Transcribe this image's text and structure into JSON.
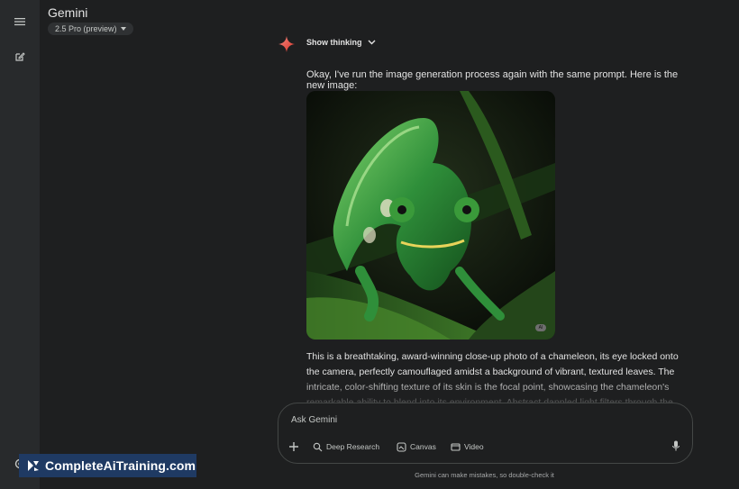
{
  "header": {
    "title": "Gemini",
    "model_label": "2.5 Pro (preview)"
  },
  "rail": {
    "menu_icon": "hamburger-menu-icon",
    "new_chat_icon": "edit-new-chat-icon",
    "settings_icon": "gear-icon"
  },
  "response": {
    "show_thinking_label": "Show thinking",
    "intro": "Okay, I've run the image generation process again with the same prompt. Here is the new image:",
    "image_badge": "AI",
    "body": "This is a breathtaking, award-winning close-up photo of a chameleon, its eye locked onto the camera, perfectly camouflaged amidst a background of vibrant, textured leaves. The intricate, color-shifting texture of its skin is the focal point, showcasing the chameleon's remarkable ability to blend into its environment. Abstract dappled light filters through the leaves, creating a"
  },
  "composer": {
    "placeholder": "Ask Gemini",
    "tools": [
      {
        "label": "Deep Research",
        "icon": "deep-research-icon"
      },
      {
        "label": "Canvas",
        "icon": "canvas-icon"
      },
      {
        "label": "Video",
        "icon": "video-icon"
      }
    ]
  },
  "disclaimer": "Gemini can make mistakes, so double-check it",
  "watermark": {
    "text": "CompleteAiTraining.com"
  },
  "colors": {
    "background": "#1e1f20",
    "rail": "#282a2c",
    "text": "#e3e3e3",
    "muted": "#c4c7c5",
    "watermark_bg": "#1f3a63"
  }
}
